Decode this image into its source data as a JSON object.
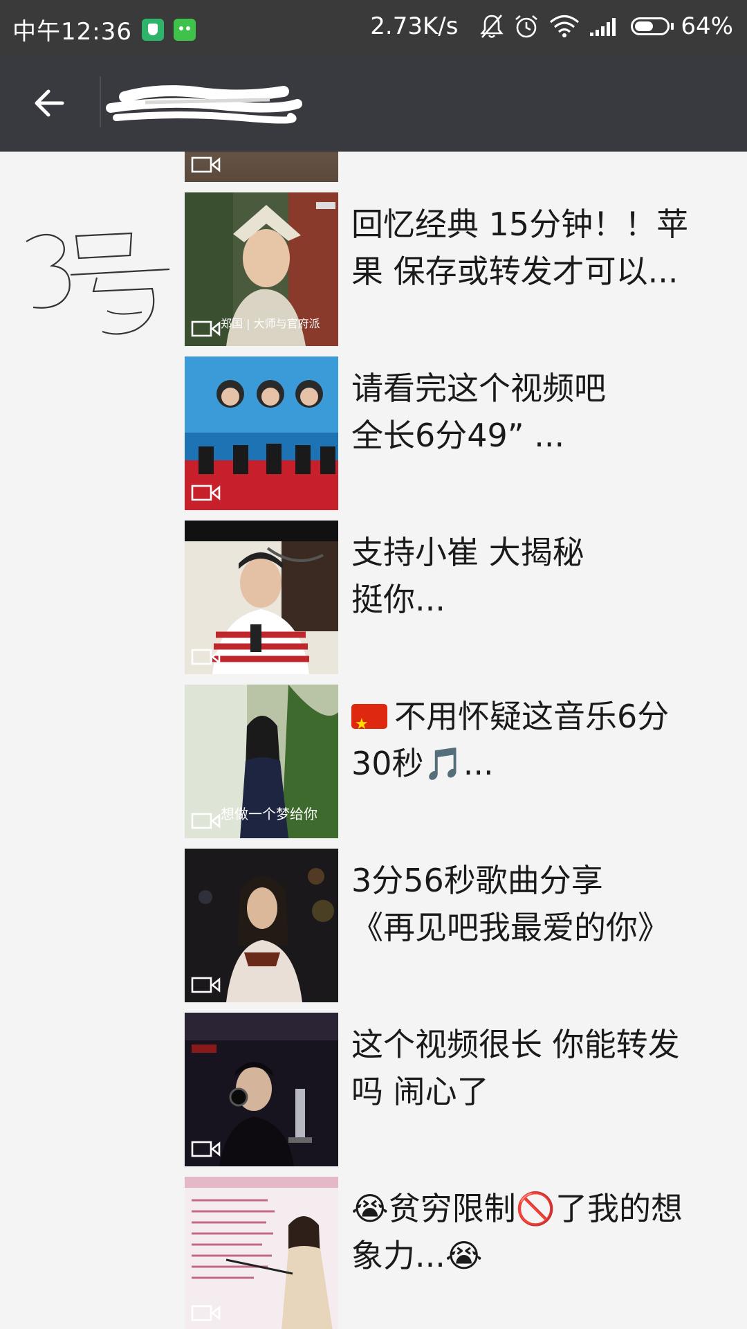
{
  "status_bar": {
    "time": "中午12:36",
    "network_speed": "2.73K/s",
    "battery_percent": "64%",
    "battery_level": 0.64,
    "icons": [
      "shield-app-icon",
      "robot-app-icon",
      "mute-bell-icon",
      "alarm-icon",
      "wifi-icon",
      "signal-icon",
      "battery-icon"
    ]
  },
  "header": {
    "back_icon": "arrow-left-icon",
    "title_redacted": true
  },
  "annotation": {
    "handwritten": "3号"
  },
  "items": [
    {
      "text": "",
      "thumb_caption": ""
    },
    {
      "text": "回忆经典 15分钟！！苹\n果 保存或转发才可以...",
      "thumb_caption": "郑国 | 大师与官府派"
    },
    {
      "text": "请看完这个视频吧\n全长6分49”  ...",
      "thumb_caption": ""
    },
    {
      "text": "支持小崔  大揭秘\n挺你...",
      "thumb_caption": ""
    },
    {
      "text": "不用怀疑这音乐6分\n30秒🎵...",
      "prefix_emoji": "china-flag",
      "thumb_caption": "想做一个梦给你"
    },
    {
      "text": "3分56秒歌曲分享\n《再见吧我最爱的你》",
      "thumb_caption": ""
    },
    {
      "text": "这个视频很长  你能转发\n吗   闹心了",
      "thumb_caption": ""
    },
    {
      "text": "😭贫穷限制🚫了我的想\n象力...😭",
      "thumb_caption": ""
    }
  ],
  "colors": {
    "status_bar_bg": "#3a3a3a",
    "title_bar_bg": "#393a3f",
    "list_bg": "#f4f4f4",
    "text": "#1a1a1a"
  }
}
